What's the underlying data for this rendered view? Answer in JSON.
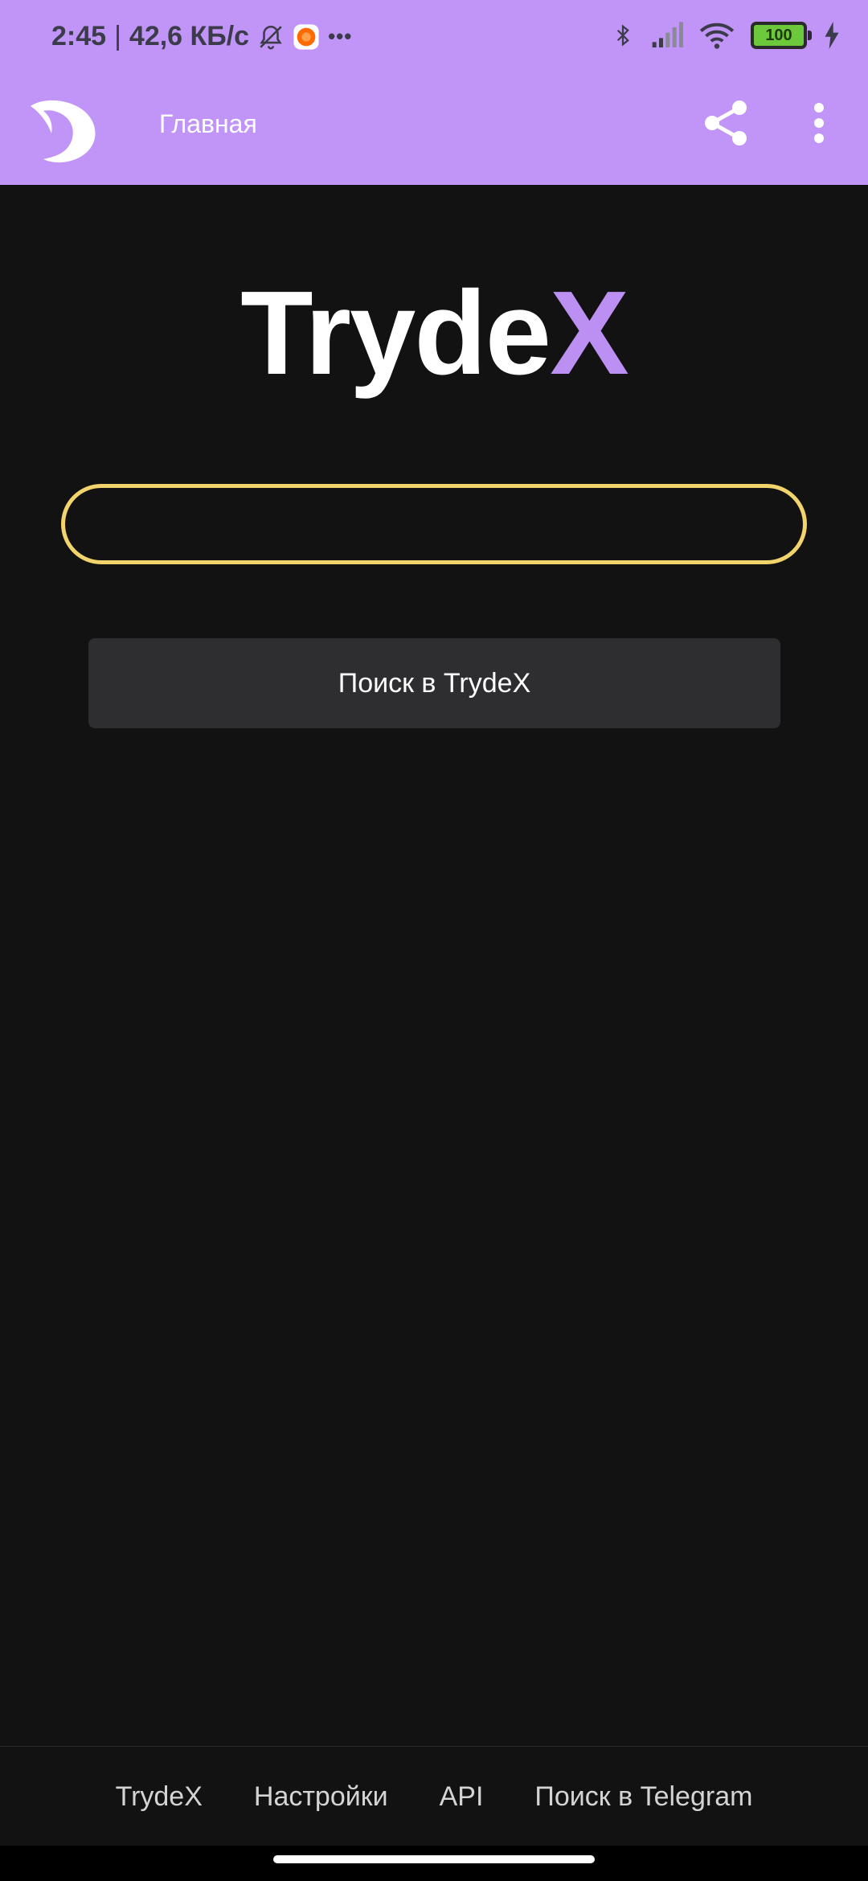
{
  "status_bar": {
    "time": "2:45",
    "separator": "|",
    "net_speed": "42,6 КБ/с",
    "overflow": "•••",
    "battery_level": "100"
  },
  "app_bar": {
    "title": "Главная",
    "icons": [
      "app-logo-icon",
      "share-icon",
      "more-vert-icon"
    ]
  },
  "brand": {
    "main": "Tryde",
    "accent": "X",
    "accent_color": "#bc8ff2"
  },
  "search": {
    "value": "",
    "placeholder": "",
    "button_label": "Поиск в TrydeX"
  },
  "footer": {
    "links": [
      "TrydeX",
      "Настройки",
      "API",
      "Поиск в Telegram"
    ]
  },
  "colors": {
    "header": "#c095f7",
    "background": "#121212",
    "input_border": "#f3d36b",
    "button_bg": "#2e2e30"
  }
}
